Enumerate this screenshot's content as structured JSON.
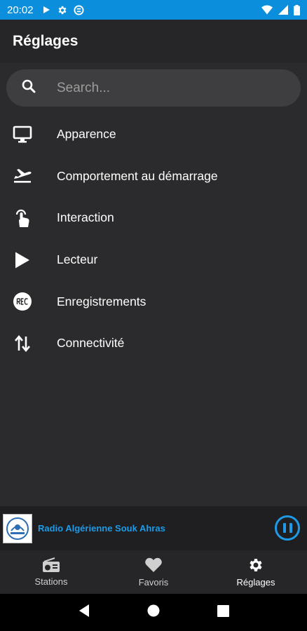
{
  "status_bar": {
    "time": "20:02",
    "icons_left": [
      "play-icon",
      "gear-icon",
      "sync-icon"
    ],
    "icons_right": [
      "wifi-icon",
      "signal-icon",
      "battery-icon"
    ]
  },
  "app_bar": {
    "title": "Réglages"
  },
  "search": {
    "placeholder": "Search...",
    "icon": "search-icon"
  },
  "settings": {
    "items": [
      {
        "label": "Apparence",
        "icon": "monitor-icon"
      },
      {
        "label": "Comportement au démarrage",
        "icon": "plane-takeoff-icon"
      },
      {
        "label": "Interaction",
        "icon": "touch-icon"
      },
      {
        "label": "Lecteur",
        "icon": "play-icon"
      },
      {
        "label": "Enregistrements",
        "icon": "rec-icon"
      },
      {
        "label": "Connectivité",
        "icon": "swap-vertical-icon"
      }
    ]
  },
  "player": {
    "station_name": "Radio Algérienne Souk Ahras",
    "state": "playing",
    "accent_color": "#1e9ae6"
  },
  "bottom_nav": {
    "items": [
      {
        "label": "Stations",
        "icon": "radio-icon"
      },
      {
        "label": "Favoris",
        "icon": "heart-icon"
      },
      {
        "label": "Réglages",
        "icon": "gear-icon"
      }
    ],
    "active": "Réglages"
  },
  "colors": {
    "status_bar": "#0b8fdc",
    "background": "#2b2b2d",
    "accent": "#1e9ae6"
  }
}
